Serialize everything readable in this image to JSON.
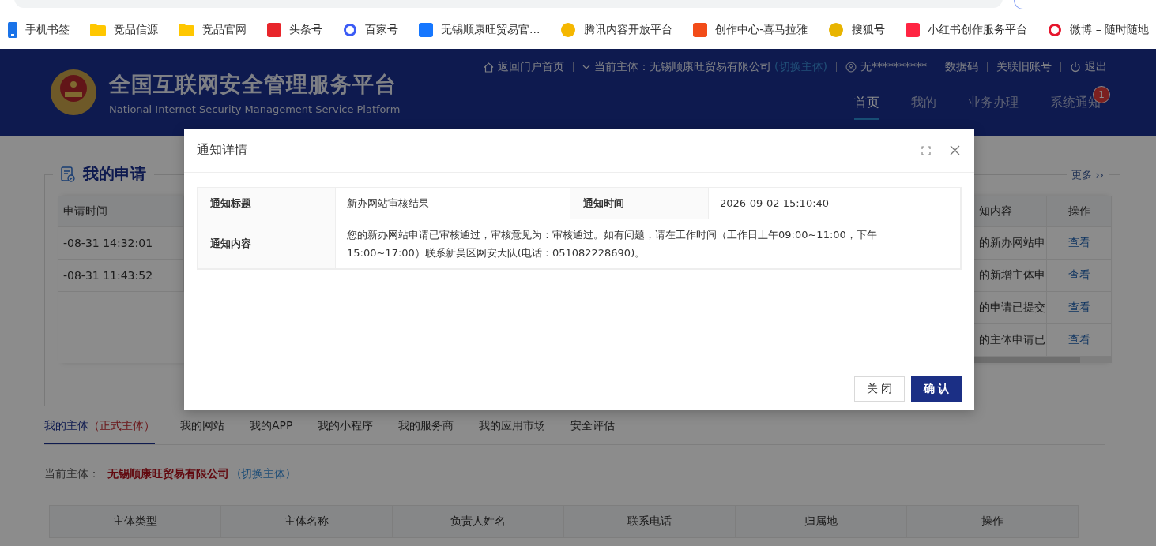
{
  "bookmarks": [
    {
      "label": "手机书签",
      "kind": "phone",
      "color": "#1a73e8"
    },
    {
      "label": "竞品信源",
      "kind": "folder",
      "color": "#ffc700"
    },
    {
      "label": "竞品官网",
      "kind": "folder",
      "color": "#ffc700"
    },
    {
      "label": "头条号",
      "kind": "square",
      "color": "#e8262b"
    },
    {
      "label": "百家号",
      "kind": "ring",
      "color": "#3b5bf5"
    },
    {
      "label": "无锡顺康旺贸易官...",
      "kind": "square",
      "color": "#1677ff"
    },
    {
      "label": "腾讯内容开放平台",
      "kind": "circle",
      "color": "#f5b700"
    },
    {
      "label": "创作中心-喜马拉雅",
      "kind": "square",
      "color": "#f24c19"
    },
    {
      "label": "搜狐号",
      "kind": "circle",
      "color": "#e8b400"
    },
    {
      "label": "小红书创作服务平台",
      "kind": "square",
      "color": "#ff2442"
    },
    {
      "label": "微博 – 随时随地",
      "kind": "ring",
      "color": "#e6162d"
    }
  ],
  "header": {
    "title": "全国互联网安全管理服务平台",
    "subtitle": "National Internet Security Management Service Platform",
    "links": [
      {
        "kind": "home",
        "label": "返回门户首页"
      },
      {
        "kind": "entity",
        "label": "当前主体：无锡顺康旺贸易有限公司",
        "link": "(切换主体)"
      },
      {
        "kind": "user",
        "label": "无**********"
      },
      {
        "kind": "plain",
        "label": "数据码"
      },
      {
        "kind": "plain",
        "label": "关联旧账号"
      },
      {
        "kind": "power",
        "label": "退出"
      }
    ],
    "nav": [
      {
        "label": "首页",
        "selected": true
      },
      {
        "label": "我的",
        "selected": false
      },
      {
        "label": "业务办理",
        "selected": false
      },
      {
        "label": "系统通知",
        "selected": false,
        "badge": "1"
      }
    ]
  },
  "applications": {
    "title": "我的申请",
    "more": "更多 ››",
    "left_header": "申请时间",
    "left_rows": [
      "-08-31 14:32:01",
      "-08-31 11:43:52"
    ],
    "right_headers": [
      "知内容",
      "操作"
    ],
    "right_rows": [
      {
        "content": "的新办网站申",
        "action": "查看"
      },
      {
        "content": "的新增主体申",
        "action": "查看"
      },
      {
        "content": "的申请已提交",
        "action": "查看"
      },
      {
        "content": "的主体申请已",
        "action": "查看"
      }
    ]
  },
  "entity_tabs": [
    {
      "label": "我的主体",
      "note": "（正式主体）",
      "selected": true
    },
    {
      "label": "我的网站",
      "selected": false
    },
    {
      "label": "我的APP",
      "selected": false
    },
    {
      "label": "我的小程序",
      "selected": false
    },
    {
      "label": "我的服务商",
      "selected": false
    },
    {
      "label": "我的应用市场",
      "selected": false
    },
    {
      "label": "安全评估",
      "selected": false
    }
  ],
  "current_entity": {
    "label": "当前主体：",
    "name": "无锡顺康旺贸易有限公司",
    "link": "(切换主体)"
  },
  "entity_table": {
    "columns": [
      "主体类型",
      "主体名称",
      "负责人姓名",
      "联系电话",
      "归属地",
      "操作"
    ]
  },
  "dialog": {
    "title": "通知详情",
    "fields": [
      {
        "label": "通知标题",
        "value": "新办网站审核结果"
      },
      {
        "label": "通知时间",
        "value": "2026-09-02 15:10:40"
      },
      {
        "label": "通知内容",
        "value": "您的新办网站申请已审核通过，审核意见为：审核通过。如有问题，请在工作时间（工作日上午09:00~11:00，下午15:00~17:00）联系新吴区网安大队(电话：051082228690)。"
      }
    ],
    "buttons": [
      {
        "label": "关 闭",
        "kind": "secondary"
      },
      {
        "label": "确 认",
        "kind": "primary"
      }
    ]
  }
}
